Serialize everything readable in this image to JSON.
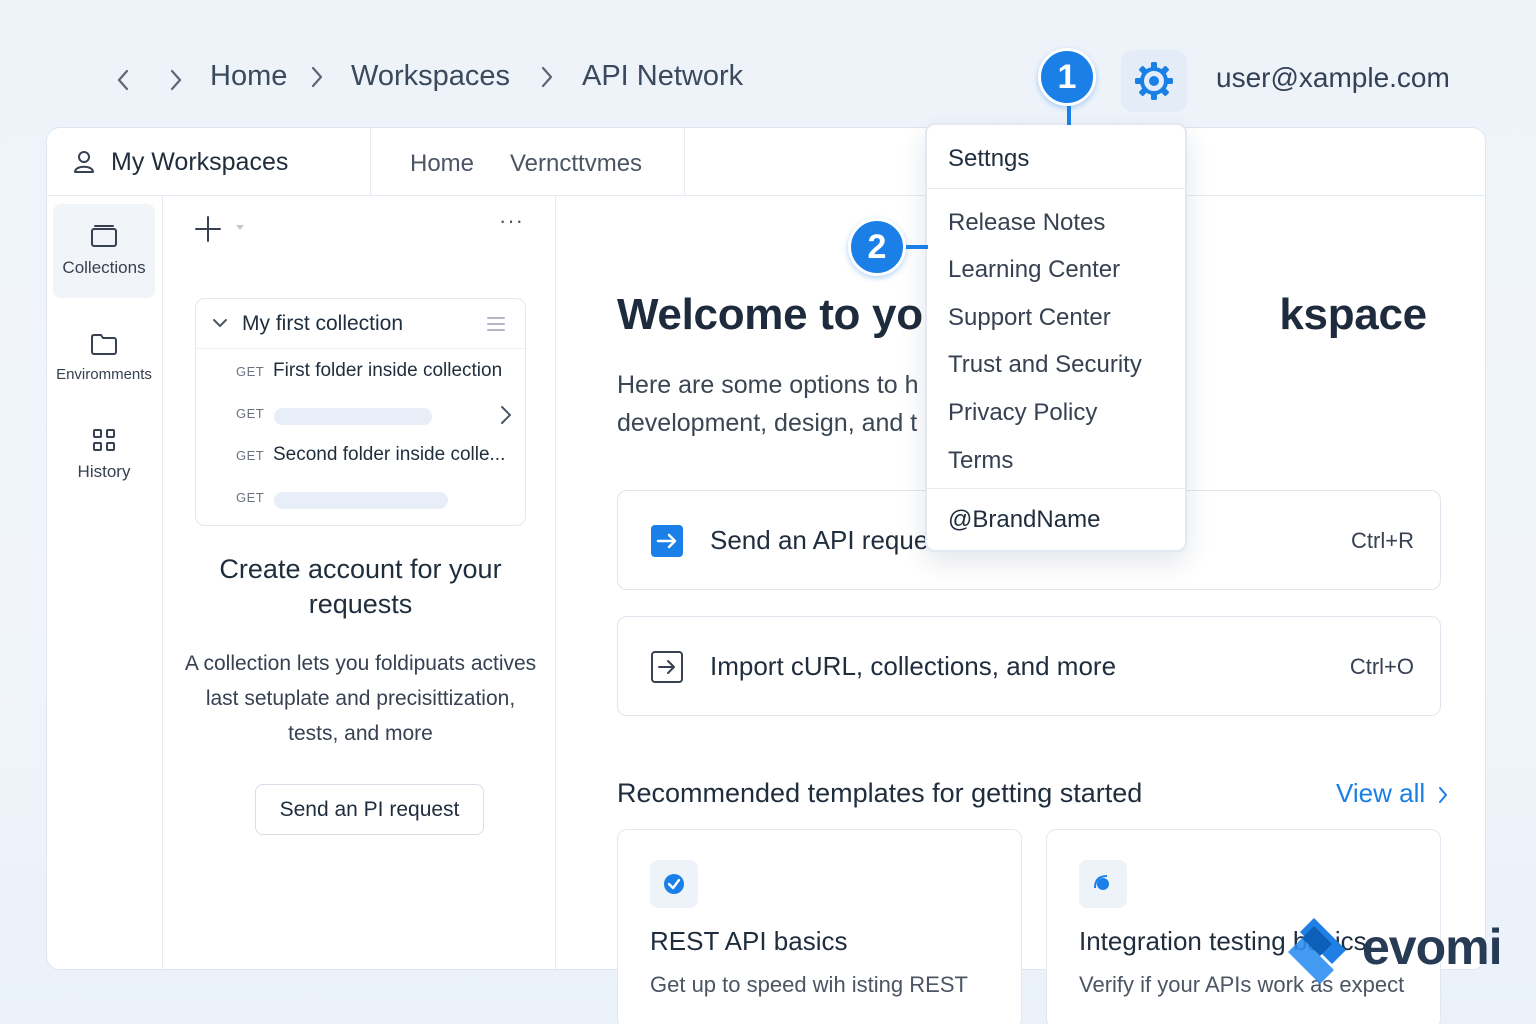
{
  "breadcrumbs": {
    "items": [
      "Home",
      "Workspaces",
      "API Network"
    ]
  },
  "header": {
    "user_email": "user@xample.com"
  },
  "steps": {
    "first": "1",
    "second": "2"
  },
  "workspace": {
    "title": "My Workspaces",
    "tabs": [
      "Home",
      "Verncttvmes"
    ]
  },
  "sidebar": {
    "items": [
      {
        "label": "Collections",
        "icon": "collections-icon"
      },
      {
        "label": "Enviromments",
        "icon": "folder-icon"
      },
      {
        "label": "History",
        "icon": "history-grid-icon"
      }
    ]
  },
  "collection": {
    "name": "My first collection",
    "requests": [
      {
        "method": "GET",
        "name": "First folder inside collection"
      },
      {
        "method": "GET",
        "name": ""
      },
      {
        "method": "GET",
        "name": "Second folder inside colle..."
      },
      {
        "method": "GET",
        "name": ""
      }
    ]
  },
  "promo": {
    "title": "Create account for your requests",
    "text": "A collection lets you foldipuats actives last setuplate and precisittization, tests, and more",
    "button": "Send an PI request"
  },
  "welcome": {
    "title": "Welcome to you",
    "title_end": "kspace",
    "subtitle_line1": "Here are some options to h",
    "subtitle_line2": "development, design, and t"
  },
  "actions": [
    {
      "label": "Send an API reque",
      "shortcut": "Ctrl+R"
    },
    {
      "label": "Import cURL, collections, and more",
      "shortcut": "Ctrl+O"
    }
  ],
  "recommended": {
    "title": "Recommended templates for getting started",
    "view_all": "View all",
    "templates": [
      {
        "title": "REST API basics",
        "desc": "Get up to speed wih isting REST"
      },
      {
        "title": "Integration testing basics",
        "desc": "Verify if your APIs work as expect"
      }
    ]
  },
  "menu": {
    "header": "Settngs",
    "items": [
      "Release Notes",
      "Learning Center",
      "Support Center",
      "Trust and Security",
      "Privacy Policy",
      "Terms"
    ],
    "footer": "@BrandName"
  },
  "logo": {
    "text": "evomi"
  },
  "colors": {
    "accent": "#1a7fe6",
    "text": "#1f2d3d",
    "border": "#dfe6ee"
  }
}
